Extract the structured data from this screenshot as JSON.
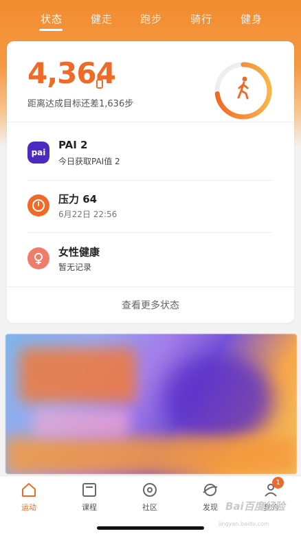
{
  "tabs": [
    {
      "label": "状态",
      "active": true
    },
    {
      "label": "健走",
      "active": false
    },
    {
      "label": "跑步",
      "active": false
    },
    {
      "label": "骑行",
      "active": false
    },
    {
      "label": "健身",
      "active": false
    }
  ],
  "steps": {
    "value": "4,364",
    "goal_text": "距离达成目标还差1,636步",
    "progress_fraction": 0.73,
    "icon": "walking-person-icon"
  },
  "status_rows": [
    {
      "icon": "pai-icon",
      "icon_text": "pai",
      "title": "PAI 2",
      "subtitle": "今日获取PAI值 2",
      "color": "#4b2bbf"
    },
    {
      "icon": "stress-gauge-icon",
      "title": "压力 64",
      "subtitle": "6月22日 22:56",
      "color": "#f06a27"
    },
    {
      "icon": "female-health-icon",
      "title": "女性健康",
      "subtitle": "暂无记录",
      "color": "#ef7d6a"
    }
  ],
  "more_link": "查看更多状态",
  "bottom_nav": [
    {
      "label": "运动",
      "icon": "home-icon",
      "active": true
    },
    {
      "label": "课程",
      "icon": "course-icon",
      "active": false
    },
    {
      "label": "社区",
      "icon": "community-icon",
      "active": false
    },
    {
      "label": "发现",
      "icon": "discover-icon",
      "active": false
    },
    {
      "label": "我的",
      "icon": "profile-icon",
      "active": false
    }
  ],
  "profile_badge": "1",
  "watermark": {
    "logo": "Bai百度经验",
    "url": "jingyan.baidu.com"
  },
  "colors": {
    "accent": "#f06a27",
    "ring_start": "#f06a27",
    "ring_end": "#f7b54a",
    "pai": "#4b2bbf"
  }
}
